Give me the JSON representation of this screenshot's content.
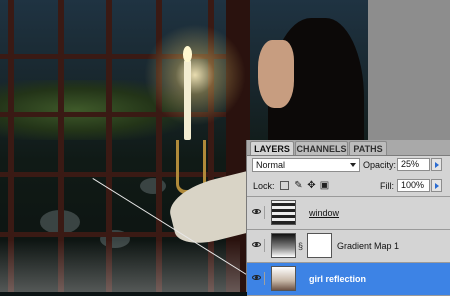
{
  "panel": {
    "tabs": [
      {
        "label": "LAYERS",
        "active": true
      },
      {
        "label": "CHANNELS",
        "active": false
      },
      {
        "label": "PATHS",
        "active": false
      }
    ],
    "blend_mode": "Normal",
    "opacity_label": "Opacity:",
    "opacity_value": "25%",
    "lock_label": "Lock:",
    "fill_label": "Fill:",
    "fill_value": "100%",
    "lock_icons": [
      "lock-transparent-icon",
      "lock-paint-brush-icon",
      "lock-position-move-icon",
      "lock-all-padlock-icon"
    ],
    "layers": [
      {
        "name": "window",
        "thumbnail": "window-thumbnail",
        "visible": true,
        "selected": false
      },
      {
        "name": "Gradient Map 1",
        "thumbnail": "gradient-map-thumbnail",
        "has_mask": true,
        "visible": true,
        "selected": false
      },
      {
        "name": "girl reflection",
        "thumbnail": "girl-reflection-thumbnail",
        "visible": true,
        "selected": true
      }
    ]
  },
  "colors": {
    "selection": "#3d83e5",
    "panel_bg": "#d4d4d4",
    "canvas_grey": "#8d8d8d"
  }
}
